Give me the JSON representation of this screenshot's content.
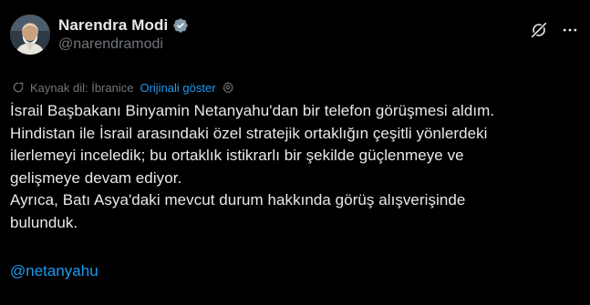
{
  "author": {
    "display_name": "Narendra Modi",
    "handle": "@narendramodi",
    "verified": true
  },
  "translation": {
    "source_label": "Kaynak dil: İbranice",
    "show_original_label": "Orijinali göster"
  },
  "tweet": {
    "lines": [
      "İsrail Başbakanı Binyamin Netanyahu'dan bir telefon görüşmesi aldım.",
      "Hindistan ile İsrail arasındaki özel stratejik ortaklığın çeşitli yönlerdeki",
      "ilerlemeyi inceledik; bu ortaklık istikrarlı bir şekilde güçlenmeye ve",
      "gelişmeye devam ediyor.",
      "Ayrıca, Batı Asya'daki mevcut durum hakkında görüş alışverişinde",
      "bulunduk."
    ],
    "mention": "@netanyahu"
  },
  "colors": {
    "background": "#000000",
    "text": "#e7e9ea",
    "muted": "#71767b",
    "link": "#1d9bf0"
  },
  "icons": {
    "verified": "verified-badge-icon",
    "grok": "grok-icon",
    "more": "more-options-icon",
    "translate": "translate-icon",
    "settings": "settings-gear-icon"
  }
}
